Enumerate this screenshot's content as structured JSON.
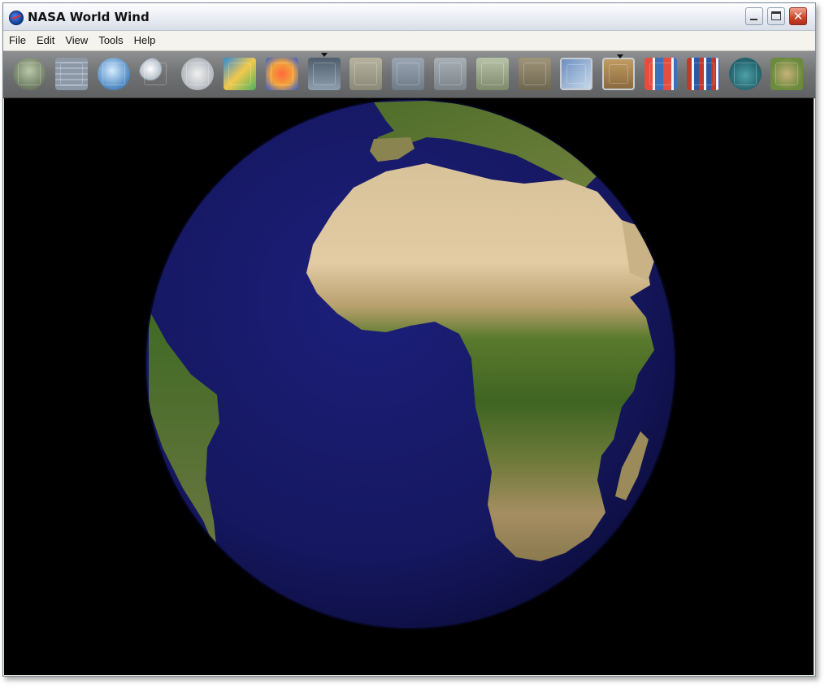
{
  "window": {
    "title": "NASA World Wind"
  },
  "menu": [
    "File",
    "Edit",
    "View",
    "Tools",
    "Help"
  ],
  "toolbar": {
    "tools": [
      {
        "name": "layer-manager",
        "icon": "layers-icon"
      },
      {
        "name": "lat-lon-grid",
        "icon": "grid-icon"
      },
      {
        "name": "place-names",
        "icon": "globe-lines-icon"
      },
      {
        "name": "search",
        "icon": "magnifier-icon"
      },
      {
        "name": "scale-bar",
        "icon": "compass-icon"
      },
      {
        "name": "weather",
        "icon": "weather-icon"
      },
      {
        "name": "temperature",
        "icon": "heatmap-icon"
      },
      {
        "name": "landsat",
        "icon": "map-tile-icon"
      },
      {
        "name": "usgs-topo",
        "icon": "map-tile-icon"
      },
      {
        "name": "usgs-urban",
        "icon": "map-tile-icon"
      },
      {
        "name": "usgs-imagery",
        "icon": "map-tile-icon"
      },
      {
        "name": "zoomit",
        "icon": "map-tile-icon"
      },
      {
        "name": "blue-marble",
        "icon": "map-tile-icon"
      },
      {
        "name": "geocover",
        "icon": "map-tile-icon"
      },
      {
        "name": "onearth",
        "icon": "map-tile-icon"
      },
      {
        "name": "flags",
        "icon": "flag-icon"
      },
      {
        "name": "boundaries",
        "icon": "flags-grid-icon"
      },
      {
        "name": "stars",
        "icon": "dome-icon"
      },
      {
        "name": "terrain",
        "icon": "terrain-icon"
      }
    ]
  },
  "colors": {
    "ocean": "#14155e",
    "space": "#000000",
    "toolbar": "#6f7173"
  }
}
